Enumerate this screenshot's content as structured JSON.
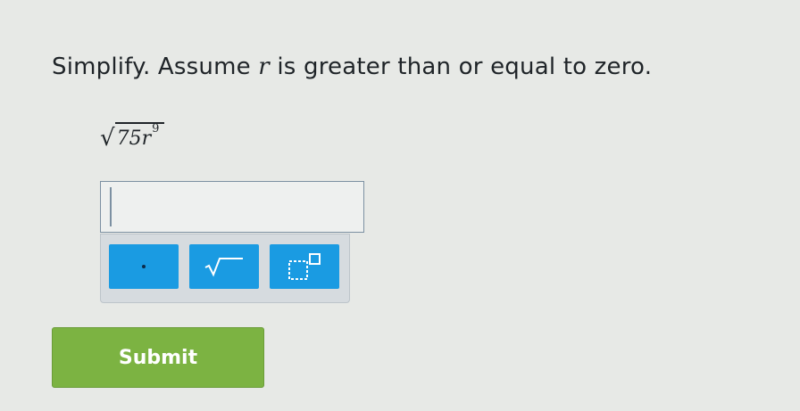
{
  "question": {
    "prompt_before": "Simplify. Assume ",
    "prompt_var": "r",
    "prompt_after": " is greater than or equal to zero.",
    "radicand_base": "75r",
    "radicand_exponent": "9"
  },
  "answer": {
    "value": ""
  },
  "keypad": {
    "keys": [
      {
        "name": "dot-key",
        "icon": "dot-icon"
      },
      {
        "name": "square-root-key",
        "icon": "square-root-icon"
      },
      {
        "name": "exponent-key",
        "icon": "exponent-box-icon"
      }
    ],
    "key_color": "#1a9be2"
  },
  "submit": {
    "label": "Submit",
    "color": "#7cb342"
  }
}
